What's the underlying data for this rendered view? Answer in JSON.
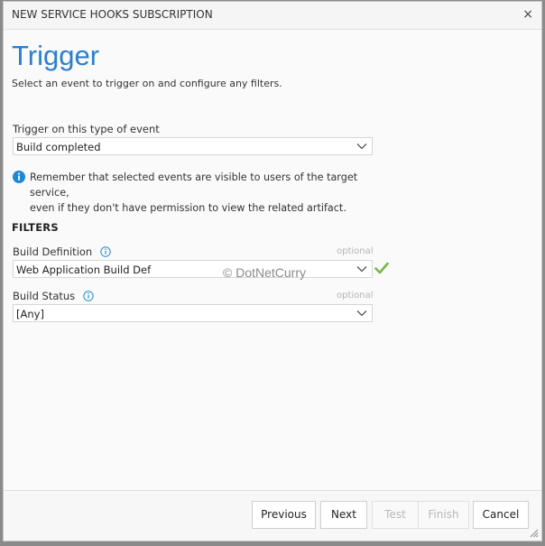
{
  "dialog": {
    "title": "NEW SERVICE HOOKS SUBSCRIPTION",
    "close_glyph": "×"
  },
  "page": {
    "heading": "Trigger",
    "subtitle": "Select an event to trigger on and configure any filters."
  },
  "trigger": {
    "label": "Trigger on this type of event",
    "value": "Build completed"
  },
  "notice": {
    "line1": "Remember that selected events are visible to users of the target service,",
    "line2": "even if they don't have permission to view the related artifact."
  },
  "filters": {
    "heading": "FILTERS",
    "build_definition": {
      "label": "Build Definition",
      "optional": "optional",
      "value": "Web Application Build Def"
    },
    "build_status": {
      "label": "Build Status",
      "optional": "optional",
      "value": "[Any]"
    }
  },
  "watermark": "© DotNetCurry",
  "footer": {
    "previous": "Previous",
    "next": "Next",
    "test": "Test",
    "finish": "Finish",
    "cancel": "Cancel"
  },
  "colors": {
    "accent": "#2a7fcf",
    "info_icon": "#1e88d8",
    "valid_check": "#7ab648"
  }
}
